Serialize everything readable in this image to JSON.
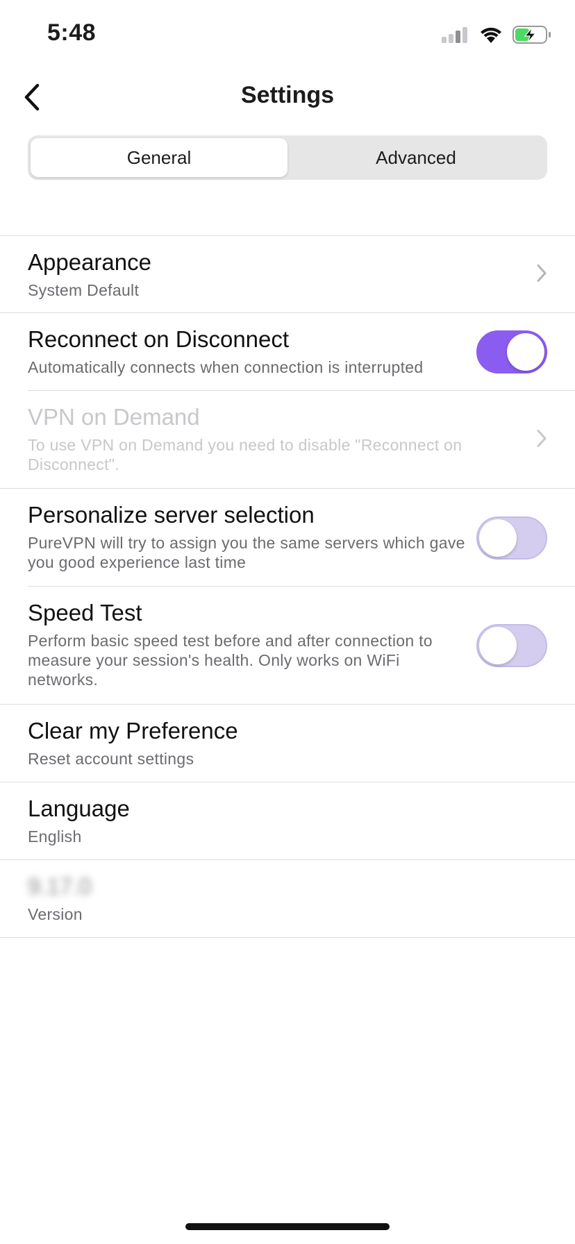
{
  "status_bar": {
    "time": "5:48"
  },
  "nav": {
    "title": "Settings"
  },
  "tabs": [
    {
      "label": "General",
      "active": true
    },
    {
      "label": "Advanced",
      "active": false
    }
  ],
  "settings": {
    "appearance": {
      "title": "Appearance",
      "subtitle": "System Default"
    },
    "reconnect": {
      "title": "Reconnect on Disconnect",
      "subtitle": "Automatically connects when connection is interrupted",
      "enabled": true
    },
    "vpn_on_demand": {
      "title": "VPN on Demand",
      "subtitle": "To use VPN on Demand you need to disable \"Reconnect on Disconnect\"."
    },
    "personalize": {
      "title": "Personalize server selection",
      "subtitle": "PureVPN will try to assign you the same servers which gave you good experience last time",
      "enabled": false
    },
    "speed_test": {
      "title": "Speed Test",
      "subtitle": "Perform basic speed test before and after connection to measure your session's health. Only works on WiFi networks.",
      "enabled": false
    },
    "clear_preference": {
      "title": "Clear my Preference",
      "subtitle": "Reset account settings"
    },
    "language": {
      "title": "Language",
      "subtitle": "English"
    },
    "version": {
      "value": "9.17.0",
      "subtitle": "Version"
    }
  },
  "colors": {
    "accent": "#8a5cf0",
    "toggle_off": "#d4cdef",
    "battery_green": "#4cd964"
  },
  "icons": {
    "back": "chevron-left-icon",
    "chevron": "chevron-right-icon",
    "signal": "cellular-signal-icon",
    "wifi": "wifi-icon",
    "battery": "battery-charging-icon"
  }
}
